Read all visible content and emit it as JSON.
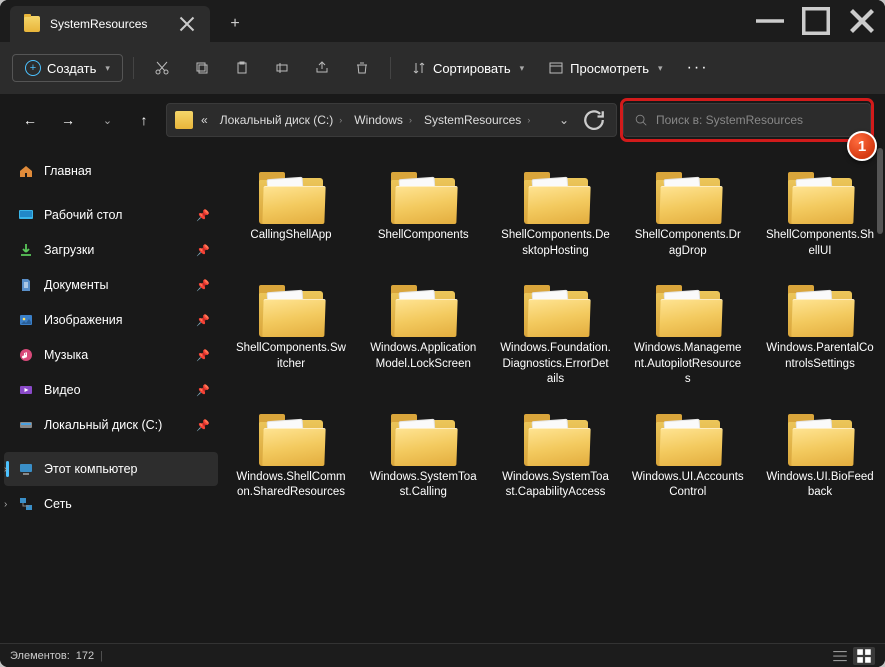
{
  "titlebar": {
    "tab_title": "SystemResources"
  },
  "toolbar": {
    "create": "Создать",
    "sort": "Сортировать",
    "view": "Просмотреть"
  },
  "breadcrumb": {
    "segments": [
      "«",
      "Локальный диск (C:)",
      "Windows",
      "SystemResources"
    ]
  },
  "search": {
    "placeholder": "Поиск в: SystemResources"
  },
  "callout": {
    "number": "1"
  },
  "sidebar": {
    "home": "Главная",
    "desktop": "Рабочий стол",
    "downloads": "Загрузки",
    "documents": "Документы",
    "pictures": "Изображения",
    "music": "Музыка",
    "videos": "Видео",
    "disk_c": "Локальный диск (C:)",
    "this_pc": "Этот компьютер",
    "network": "Сеть"
  },
  "folders": [
    "CallingShellApp",
    "ShellComponents",
    "ShellComponents.DesktopHosting",
    "ShellComponents.DragDrop",
    "ShellComponents.ShellUI",
    "ShellComponents.Switcher",
    "Windows.ApplicationModel.LockScreen",
    "Windows.Foundation.Diagnostics.ErrorDetails",
    "Windows.Management.AutopilotResources",
    "Windows.ParentalControlsSettings",
    "Windows.ShellCommon.SharedResources",
    "Windows.SystemToast.Calling",
    "Windows.SystemToast.CapabilityAccess",
    "Windows.UI.AccountsControl",
    "Windows.UI.BioFeedback"
  ],
  "status": {
    "items_label": "Элементов:",
    "count": "172"
  }
}
